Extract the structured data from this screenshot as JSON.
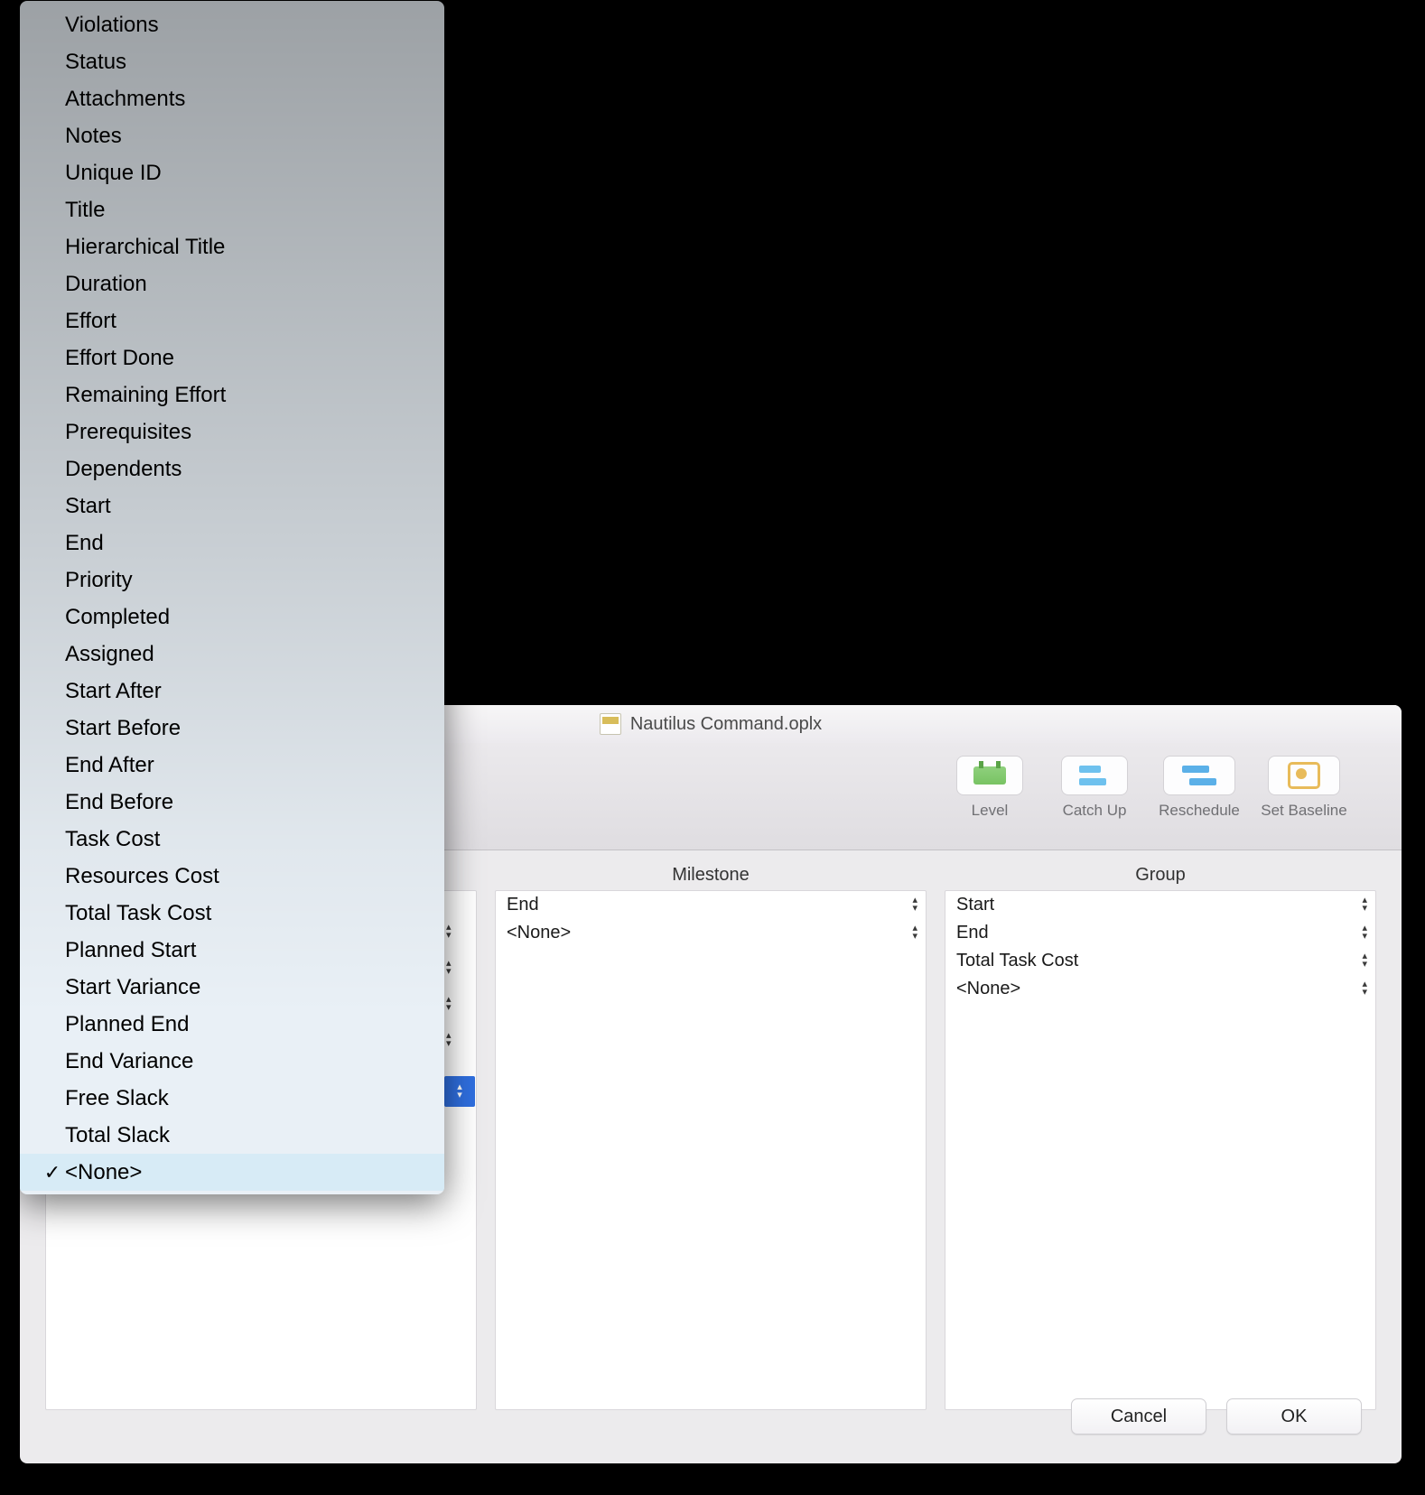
{
  "window": {
    "title": "Nautilus Command.oplx"
  },
  "toolbar": {
    "buttons": [
      {
        "name": "level",
        "label": "Level"
      },
      {
        "name": "catch-up",
        "label": "Catch Up"
      },
      {
        "name": "reschedule",
        "label": "Reschedule"
      },
      {
        "name": "set-baseline",
        "label": "Set Baseline"
      }
    ]
  },
  "columns": {
    "milestone": {
      "header": "Milestone",
      "rows": [
        "End",
        "<None>"
      ]
    },
    "group": {
      "header": "Group",
      "rows": [
        "Start",
        "End",
        "Total Task Cost",
        "<None>"
      ]
    }
  },
  "dialog": {
    "cancel": "Cancel",
    "ok": "OK"
  },
  "popup": {
    "selected": "<None>",
    "items": [
      "Violations",
      "Status",
      "Attachments",
      "Notes",
      "Unique ID",
      "Title",
      "Hierarchical Title",
      "Duration",
      "Effort",
      "Effort Done",
      "Remaining Effort",
      "Prerequisites",
      "Dependents",
      "Start",
      "End",
      "Priority",
      "Completed",
      "Assigned",
      "Start After",
      "Start Before",
      "End After",
      "End Before",
      "Task Cost",
      "Resources Cost",
      "Total Task Cost",
      "Planned Start",
      "Start Variance",
      "Planned End",
      "End Variance",
      "Free Slack",
      "Total Slack",
      "<None>"
    ]
  }
}
